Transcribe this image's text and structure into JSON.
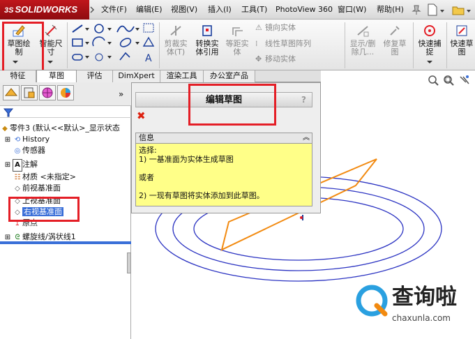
{
  "app": {
    "logo_prefix": "3S",
    "logo": "SOLIDWORKS"
  },
  "menu": [
    "文件(F)",
    "编辑(E)",
    "视图(V)",
    "插入(I)",
    "工具(T)",
    "PhotoView 360",
    "窗口(W)",
    "帮助(H)"
  ],
  "ribbon": {
    "sketch": "草图绘\n制",
    "smart_dim": "智能尺\n寸",
    "trim": "剪裁实\n体(T)",
    "convert": "转换实\n体引用",
    "offset": "等距实\n体",
    "mirror": "镜向实体",
    "linear_pattern": "线性草图阵列",
    "move": "移动实体",
    "show_delete": "显示/删\n除几...",
    "repair": "修复草\n图",
    "quick_snap": "快速捕\n捉",
    "rapid_sketch": "快速草\n图"
  },
  "tabs": [
    "特征",
    "草图",
    "评估",
    "DimXpert",
    "渲染工具",
    "办公室产品"
  ],
  "pm": {
    "title": "编辑草图",
    "help": "?",
    "info_label": "信息",
    "info_lines": [
      "选择:",
      "1) 一基准面为实体生成草图",
      "",
      "或者",
      "",
      "2) 一现有草图将实体添加到此草图。"
    ]
  },
  "tree": {
    "root": "零件3 (默认<<默认>_显示状态",
    "items": [
      "History",
      "传感器",
      "注解",
      "材质 <未指定>",
      "前视基准面",
      "上视基准面",
      "右视基准面",
      "原点",
      "螺旋线/涡状线1"
    ]
  },
  "watermark": {
    "title": "查询啦",
    "url": "chaxunla.com"
  },
  "colors": {
    "accent": "#e41e26",
    "brand": "#c0171c",
    "selection": "#3a6fd8",
    "info_bg": "#ffff88"
  }
}
